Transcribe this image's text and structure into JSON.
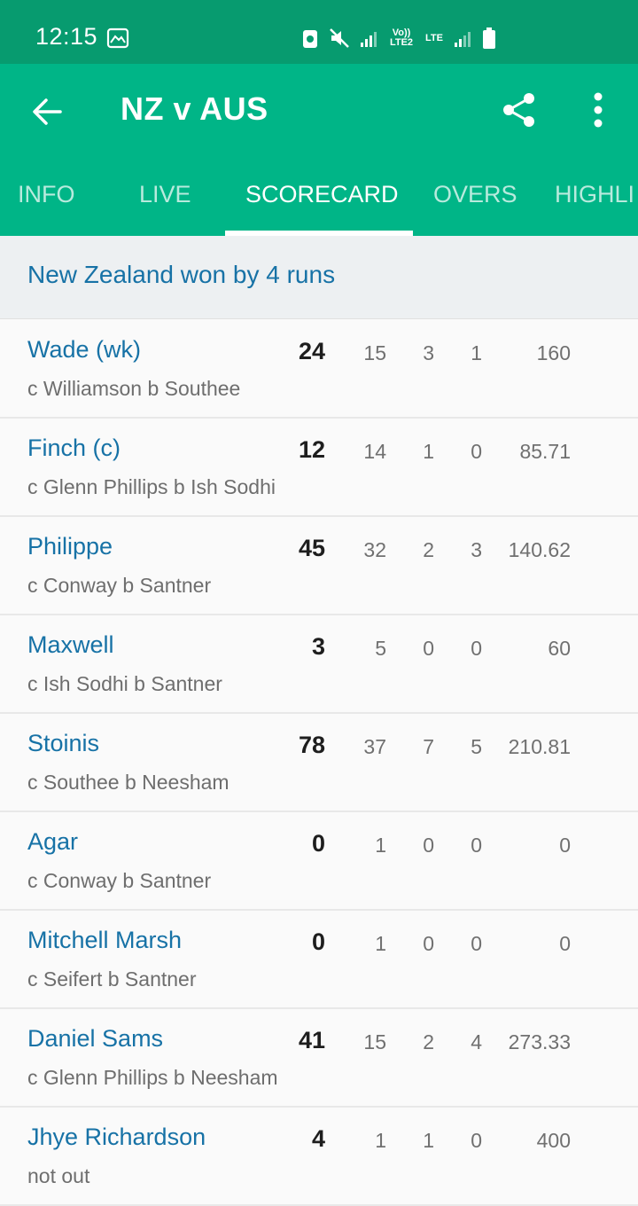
{
  "status_bar": {
    "time": "12:15",
    "network_label_1": "Vo)) LTE2",
    "network_label_2": "LTE"
  },
  "app_bar": {
    "title": "NZ v AUS"
  },
  "tabs": [
    {
      "label": "INFO",
      "active": false
    },
    {
      "label": "LIVE",
      "active": false
    },
    {
      "label": "SCORECARD",
      "active": true
    },
    {
      "label": "OVERS",
      "active": false
    },
    {
      "label": "HIGHLI",
      "active": false
    }
  ],
  "result": "New Zealand won by 4 runs",
  "batting": [
    {
      "name": "Wade (wk)",
      "dismissal": "c Williamson b Southee",
      "runs": "24",
      "balls": "15",
      "fours": "3",
      "sixes": "1",
      "sr": "160"
    },
    {
      "name": "Finch (c)",
      "dismissal": "c Glenn Phillips b Ish Sodhi",
      "runs": "12",
      "balls": "14",
      "fours": "1",
      "sixes": "0",
      "sr": "85.71"
    },
    {
      "name": "Philippe",
      "dismissal": "c Conway b Santner",
      "runs": "45",
      "balls": "32",
      "fours": "2",
      "sixes": "3",
      "sr": "140.62"
    },
    {
      "name": "Maxwell",
      "dismissal": "c Ish Sodhi b Santner",
      "runs": "3",
      "balls": "5",
      "fours": "0",
      "sixes": "0",
      "sr": "60"
    },
    {
      "name": "Stoinis",
      "dismissal": "c Southee b Neesham",
      "runs": "78",
      "balls": "37",
      "fours": "7",
      "sixes": "5",
      "sr": "210.81"
    },
    {
      "name": "Agar",
      "dismissal": "c Conway b Santner",
      "runs": "0",
      "balls": "1",
      "fours": "0",
      "sixes": "0",
      "sr": "0"
    },
    {
      "name": "Mitchell Marsh",
      "dismissal": "c Seifert b Santner",
      "runs": "0",
      "balls": "1",
      "fours": "0",
      "sixes": "0",
      "sr": "0"
    },
    {
      "name": "Daniel Sams",
      "dismissal": "c Glenn Phillips b Neesham",
      "runs": "41",
      "balls": "15",
      "fours": "2",
      "sixes": "4",
      "sr": "273.33"
    },
    {
      "name": "Jhye Richardson",
      "dismissal": "not out",
      "runs": "4",
      "balls": "1",
      "fours": "1",
      "sixes": "0",
      "sr": "400"
    }
  ],
  "colors": {
    "status_bar_bg": "#079b6f",
    "app_bar_bg": "#00b587",
    "link_blue": "#1772a6",
    "result_bg": "#edf0f2"
  },
  "icons": [
    "gallery-icon",
    "recycle-icon",
    "mute-icon",
    "signal-icon",
    "battery-icon",
    "back-arrow-icon",
    "share-icon",
    "more-vert-icon"
  ]
}
